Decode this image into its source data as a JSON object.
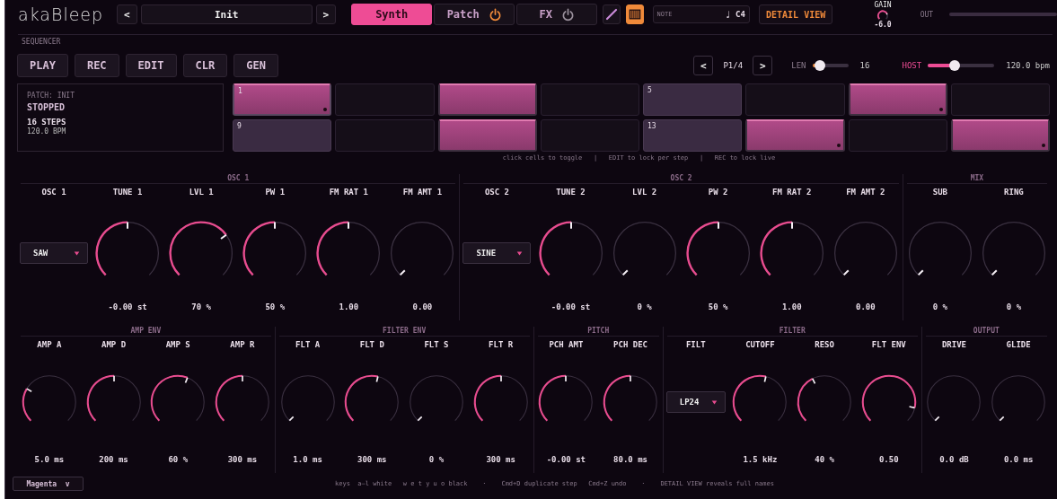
{
  "header": {
    "logo": "akaBleep",
    "prev": "<",
    "patch_name": "Init",
    "next": ">",
    "tabs": [
      {
        "label": "Synth",
        "kind": "plain",
        "selected": true
      },
      {
        "label": "Patch",
        "kind": "toggle",
        "selected": false,
        "on": true
      },
      {
        "label": "FX",
        "kind": "toggle",
        "selected": false,
        "on": false
      }
    ],
    "tools": [
      {
        "kind": "pencil",
        "selected": false
      },
      {
        "kind": "keyboard",
        "selected": true
      }
    ],
    "note": {
      "label": "NOTE",
      "glyph": "♩",
      "value": "C4"
    },
    "detail_view": "DETAIL VIEW",
    "gain": {
      "label": "GAIN",
      "value": "-6.0"
    },
    "out": {
      "label": "OUT"
    }
  },
  "sequencer": {
    "title": "SEQUENCER",
    "buttons": [
      "PLAY",
      "REC",
      "EDIT",
      "CLR",
      "GEN"
    ],
    "page": {
      "prev": "<",
      "label": "P1/4",
      "next": ">"
    },
    "len": {
      "label": "LEN",
      "level": 0.2,
      "value": "16"
    },
    "host": {
      "label": "HOST",
      "level": 0.4,
      "value": "120.0 bpm"
    },
    "info": {
      "patch": "PATCH: INIT",
      "state": "STOPPED",
      "steps": "16 STEPS",
      "bpm": "120.0 BPM"
    },
    "steps": [
      {
        "label": "1",
        "on": true,
        "beat": true,
        "locked": true
      },
      {
        "on": false,
        "beat": false,
        "locked": false
      },
      {
        "on": true,
        "beat": false,
        "locked": false
      },
      {
        "on": false,
        "beat": false,
        "locked": false
      },
      {
        "label": "5",
        "on": false,
        "beat": true,
        "locked": false
      },
      {
        "on": false,
        "beat": false,
        "locked": false
      },
      {
        "on": true,
        "beat": false,
        "locked": true
      },
      {
        "on": false,
        "beat": false,
        "locked": false
      },
      {
        "label": "9",
        "on": false,
        "beat": true,
        "locked": false
      },
      {
        "on": false,
        "beat": false,
        "locked": false
      },
      {
        "on": true,
        "beat": false,
        "locked": false
      },
      {
        "on": false,
        "beat": false,
        "locked": false
      },
      {
        "label": "13",
        "on": false,
        "beat": true,
        "locked": false
      },
      {
        "on": true,
        "beat": false,
        "locked": true
      },
      {
        "on": false,
        "beat": false,
        "locked": false
      },
      {
        "on": true,
        "beat": false,
        "locked": true
      }
    ],
    "hint": "click cells to toggle   |   EDIT to lock per step   |   REC to lock live"
  },
  "rows": [
    [
      {
        "title": "OSC 1",
        "controls": [
          {
            "kind": "select",
            "label": "OSC 1",
            "value": "SAW"
          },
          {
            "kind": "knob",
            "label": "TUNE 1",
            "value": "-0.00 st"
          },
          {
            "kind": "knob",
            "label": "LVL 1",
            "value": "70 %"
          },
          {
            "kind": "knob",
            "label": "PW 1",
            "value": "50 %"
          },
          {
            "kind": "knob",
            "label": "FM RAT 1",
            "value": "1.00"
          },
          {
            "kind": "knob",
            "label": "FM AMT 1",
            "value": "0.00"
          }
        ]
      },
      {
        "title": "OSC 2",
        "controls": [
          {
            "kind": "select",
            "label": "OSC 2",
            "value": "SINE"
          },
          {
            "kind": "knob",
            "label": "TUNE 2",
            "value": "-0.00 st"
          },
          {
            "kind": "knob",
            "label": "LVL 2",
            "value": "0 %"
          },
          {
            "kind": "knob",
            "label": "PW 2",
            "value": "50 %"
          },
          {
            "kind": "knob",
            "label": "FM RAT 2",
            "value": "1.00"
          },
          {
            "kind": "knob",
            "label": "FM AMT 2",
            "value": "0.00"
          }
        ]
      },
      {
        "title": "MIX",
        "controls": [
          {
            "kind": "knob",
            "label": "SUB",
            "value": "0 %"
          },
          {
            "kind": "knob",
            "label": "RING",
            "value": "0 %"
          }
        ]
      }
    ],
    [
      {
        "title": "AMP ENV",
        "controls": [
          {
            "kind": "knob",
            "label": "AMP A",
            "value": "5.0 ms"
          },
          {
            "kind": "knob",
            "label": "AMP D",
            "value": "200 ms"
          },
          {
            "kind": "knob",
            "label": "AMP S",
            "value": "60 %"
          },
          {
            "kind": "knob",
            "label": "AMP R",
            "value": "300 ms"
          }
        ]
      },
      {
        "title": "FILTER ENV",
        "controls": [
          {
            "kind": "knob",
            "label": "FLT A",
            "value": "1.0 ms"
          },
          {
            "kind": "knob",
            "label": "FLT D",
            "value": "300 ms"
          },
          {
            "kind": "knob",
            "label": "FLT S",
            "value": "0 %"
          },
          {
            "kind": "knob",
            "label": "FLT R",
            "value": "300 ms"
          }
        ]
      },
      {
        "title": "PITCH",
        "controls": [
          {
            "kind": "knob",
            "label": "PCH AMT",
            "value": "-0.00 st"
          },
          {
            "kind": "knob",
            "label": "PCH DEC",
            "value": "80.0 ms"
          }
        ]
      },
      {
        "title": "FILTER",
        "controls": [
          {
            "kind": "select",
            "label": "FILT",
            "value": "LP24"
          },
          {
            "kind": "knob",
            "label": "CUTOFF",
            "value": "1.5 kHz"
          },
          {
            "kind": "knob",
            "label": "RESO",
            "value": "40 %"
          },
          {
            "kind": "knob",
            "label": "FLT ENV",
            "value": "0.50"
          }
        ]
      },
      {
        "title": "OUTPUT",
        "controls": [
          {
            "kind": "knob",
            "label": "DRIVE",
            "value": "0.0 dB"
          },
          {
            "kind": "knob",
            "label": "GLIDE",
            "value": "0.0 ms"
          }
        ]
      }
    ]
  ],
  "footer": {
    "theme": "Magenta",
    "theme_caret": "v",
    "hint": "keys  a–l white   w e t y u o black    ·    Cmd+D duplicate step   Cmd+Z undo    ·    DETAIL VIEW reveals full names"
  }
}
